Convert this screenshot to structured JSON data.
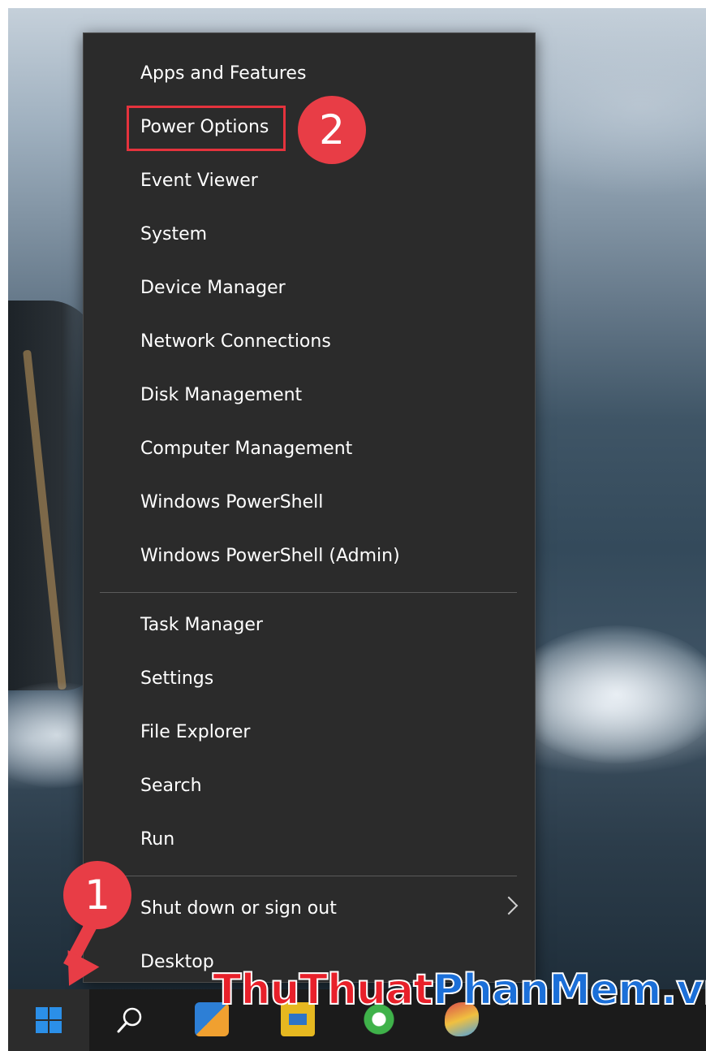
{
  "context_menu": {
    "items": [
      {
        "label": "Apps and Features"
      },
      {
        "label": "Power Options"
      },
      {
        "label": "Event Viewer"
      },
      {
        "label": "System"
      },
      {
        "label": "Device Manager"
      },
      {
        "label": "Network Connections"
      },
      {
        "label": "Disk Management"
      },
      {
        "label": "Computer Management"
      },
      {
        "label": "Windows PowerShell"
      },
      {
        "label": "Windows PowerShell (Admin)"
      },
      {
        "label": "Task Manager"
      },
      {
        "label": "Settings"
      },
      {
        "label": "File Explorer"
      },
      {
        "label": "Search"
      },
      {
        "label": "Run"
      },
      {
        "label": "Shut down or sign out"
      },
      {
        "label": "Desktop"
      }
    ]
  },
  "annotations": {
    "step_1": "1",
    "step_2": "2",
    "highlight_color": "#e5333d",
    "badge_color": "#e83d46"
  },
  "taskbar": {
    "start_icon": "windows-logo-icon",
    "search_icon": "search-icon",
    "pinned_apps": [
      "app-icon-1",
      "app-icon-2",
      "app-icon-3",
      "app-icon-4"
    ]
  },
  "watermark": {
    "part1": "ThuThuat",
    "part2": "PhanMem.vn"
  },
  "colors": {
    "menu_bg": "#2b2b2b",
    "menu_text": "#ffffff",
    "taskbar_bg": "#1b1b1b",
    "accent_blue": "#2b8fe8"
  }
}
